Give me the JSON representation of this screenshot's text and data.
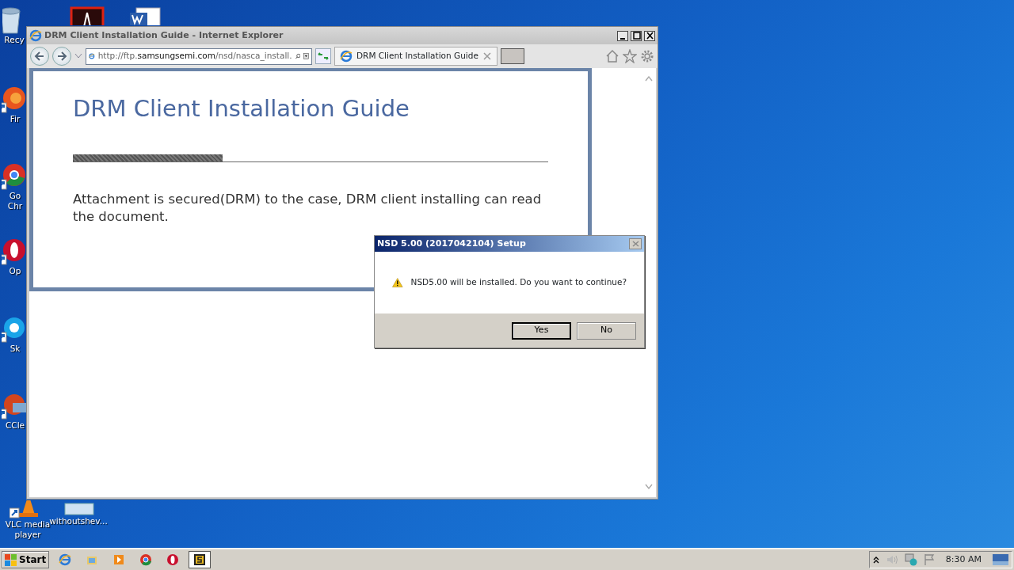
{
  "desktop_icons": [
    {
      "kind": "recycle",
      "lines": [
        "Recy"
      ]
    },
    {
      "kind": "acrobat"
    },
    {
      "kind": "word"
    },
    {
      "kind": "firefox",
      "lines": [
        "Fir"
      ]
    },
    {
      "kind": "chrome",
      "lines": [
        "Go",
        "Chr"
      ]
    },
    {
      "kind": "opera",
      "lines": [
        "Op"
      ]
    },
    {
      "kind": "skype",
      "lines": [
        "Sk"
      ]
    },
    {
      "kind": "ccleaner",
      "lines": [
        "CCle"
      ]
    },
    {
      "kind": "vlc",
      "lines": [
        "VLC media",
        "player"
      ]
    },
    {
      "kind": "file",
      "lines": [
        "withoutshev..."
      ]
    }
  ],
  "browser": {
    "title": "DRM Client Installation Guide - Internet Explorer",
    "address": "http://ftp.**samsungsemi.com**/nsd/nasca_install.",
    "tabs": [
      {
        "label": "DRM Client Installation Guide",
        "selected": true
      }
    ],
    "page": {
      "heading": "DRM Client Installation Guide",
      "progress": {
        "level": 0.315
      },
      "text": "Attachment is secured(DRM) to the case, DRM client installing can read the document."
    }
  },
  "dialog": {
    "title": "NSD 5.00 (2017042104) Setup",
    "message": "NSD5.00 will be installed. Do you want to continue?",
    "buttons": [
      {
        "label": "Yes",
        "default": true
      },
      {
        "label": "No",
        "default": false
      }
    ]
  },
  "taskbar": {
    "start": "Start",
    "apps": [
      {
        "kind": "ie",
        "active": false
      },
      {
        "kind": "folder",
        "active": false
      },
      {
        "kind": "media",
        "active": false
      },
      {
        "kind": "chrome",
        "active": false
      },
      {
        "kind": "opera",
        "active": false
      },
      {
        "kind": "sapp",
        "active": true
      }
    ],
    "time": "8:30 AM"
  }
}
